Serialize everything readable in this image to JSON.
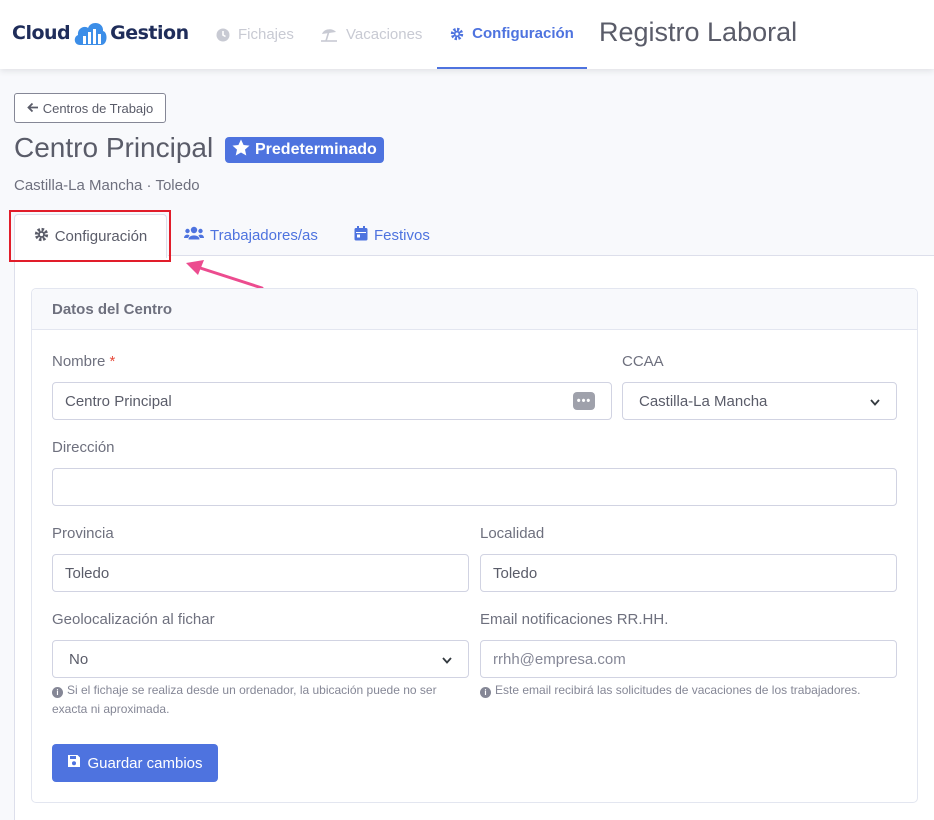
{
  "brand": {
    "part1": "Cloud",
    "part2": "Gestion"
  },
  "nav": {
    "fichajes": "Fichajes",
    "vacaciones": "Vacaciones",
    "configuracion": "Configuración"
  },
  "app_title": "Registro Laboral",
  "back_label": "Centros de Trabajo",
  "center": {
    "title": "Centro Principal",
    "badge": "Predeterminado",
    "subtitle": "Castilla-La Mancha · Toledo"
  },
  "tabs": {
    "config": "Configuración",
    "trabajadores": "Trabajadores/as",
    "festivos": "Festivos"
  },
  "card_title": "Datos del Centro",
  "form": {
    "nombre_label": "Nombre",
    "nombre_required": "*",
    "nombre_value": "Centro Principal",
    "ccaa_label": "CCAA",
    "ccaa_value": "Castilla-La Mancha",
    "direccion_label": "Dirección",
    "direccion_value": "",
    "provincia_label": "Provincia",
    "provincia_value": "Toledo",
    "localidad_label": "Localidad",
    "localidad_value": "Toledo",
    "geo_label": "Geolocalización al fichar",
    "geo_value": "No",
    "geo_help": "Si el fichaje se realiza desde un ordenador, la ubicación puede no ser exacta ni aproximada.",
    "email_label": "Email notificaciones RR.HH.",
    "email_placeholder": "rrhh@empresa.com",
    "email_help": "Este email recibirá las solicitudes de vacaciones de los trabajadores."
  },
  "save_label": "Guardar cambios",
  "colors": {
    "primary": "#4e73df",
    "highlight": "#e11d2a",
    "arrow": "#ec4c8f"
  }
}
